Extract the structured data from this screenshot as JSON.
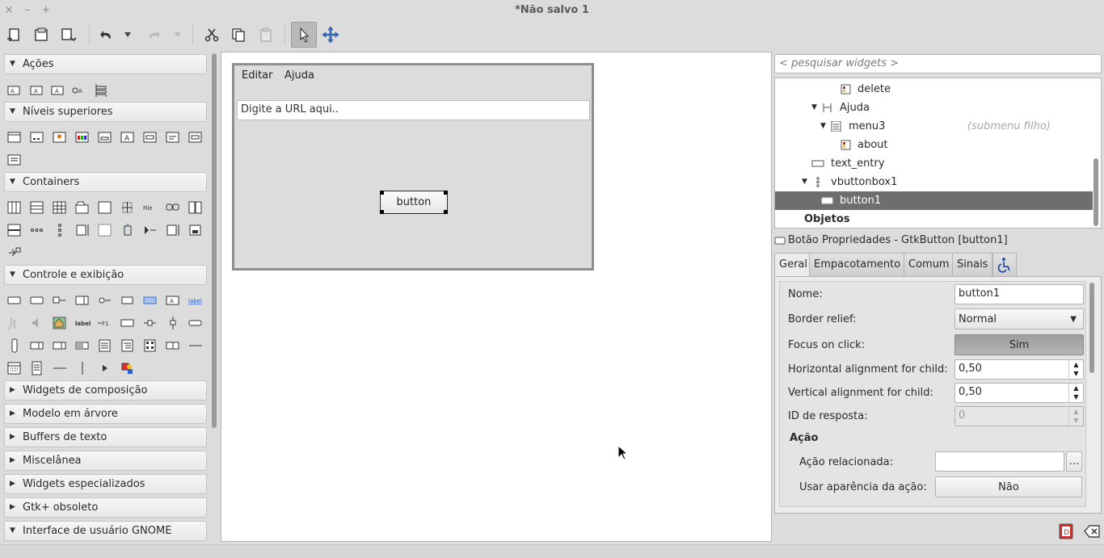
{
  "window": {
    "title": "*Não salvo 1",
    "close": "×",
    "minimize": "–",
    "maximize": "+"
  },
  "toolbar": {
    "items": [
      "new-icon",
      "open-icon",
      "save-icon",
      "undo-icon",
      "undo-menu-icon",
      "redo-icon",
      "redo-menu-icon",
      "cut-icon",
      "copy-icon",
      "paste-icon",
      "select-pointer-icon",
      "drag-resize-icon"
    ]
  },
  "palette": {
    "sections": [
      {
        "label": "Ações",
        "expanded": true
      },
      {
        "label": "Níveis superiores",
        "expanded": true
      },
      {
        "label": "Containers",
        "expanded": true
      },
      {
        "label": "Controle e exibição",
        "expanded": true
      },
      {
        "label": "Widgets de composição",
        "expanded": false
      },
      {
        "label": "Modelo em árvore",
        "expanded": false
      },
      {
        "label": "Buffers de texto",
        "expanded": false
      },
      {
        "label": "Miscelânea",
        "expanded": false
      },
      {
        "label": "Widgets especializados",
        "expanded": false
      },
      {
        "label": "Gtk+ obsoleto",
        "expanded": false
      },
      {
        "label": "Interface de usuário GNOME",
        "expanded": true
      }
    ],
    "icon_labels": {
      "file": "File",
      "label": "label",
      "label2": "label",
      "f1": "F1"
    }
  },
  "canvas": {
    "menubar": [
      "Editar",
      "Ajuda"
    ],
    "url_entry": "Digite a URL aqui..",
    "button_label": "button"
  },
  "inspector": {
    "search_placeholder": "< pesquisar widgets >",
    "tree": [
      {
        "label": "delete",
        "note": ""
      },
      {
        "label": "Ajuda",
        "note": ""
      },
      {
        "label": "menu3",
        "note": "(submenu filho)"
      },
      {
        "label": "about",
        "note": ""
      },
      {
        "label": "text_entry",
        "note": ""
      },
      {
        "label": "vbuttonbox1",
        "note": ""
      },
      {
        "label": "button1",
        "note": "",
        "selected": true
      },
      {
        "label": "Objetos",
        "note": ""
      }
    ]
  },
  "properties": {
    "header": "Botão Propriedades - GtkButton [button1]",
    "tabs": [
      "Geral",
      "Empacotamento",
      "Comum",
      "Sinais"
    ],
    "active_tab": "Geral",
    "name_label": "Nome:",
    "name_value": "button1",
    "relief_label": "Border relief:",
    "relief_value": "Normal",
    "focus_label": "Focus on click:",
    "focus_value": "Sim",
    "halign_label": "Horizontal alignment for child:",
    "halign_value": "0,50",
    "valign_label": "Vertical alignment for child:",
    "valign_value": "0,50",
    "response_label": "ID de resposta:",
    "response_value": "0",
    "action_section": "Ação",
    "related_action_label": "Ação relacionada:",
    "related_action_value": "",
    "related_action_button": "...",
    "use_action_label": "Usar aparência da ação:",
    "use_action_value": "Não"
  }
}
